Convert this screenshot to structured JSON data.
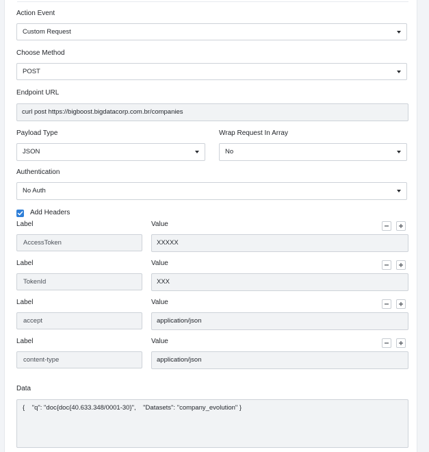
{
  "action_event": {
    "label": "Action Event",
    "value": "Custom Request"
  },
  "choose_method": {
    "label": "Choose Method",
    "value": "POST"
  },
  "endpoint_url": {
    "label": "Endpoint URL",
    "value": "curl post https://bigboost.bigdatacorp.com.br/companies"
  },
  "payload_type": {
    "label": "Payload Type",
    "value": "JSON"
  },
  "wrap_request": {
    "label": "Wrap Request In Array",
    "value": "No"
  },
  "authentication": {
    "label": "Authentication",
    "value": "No Auth"
  },
  "add_headers": {
    "label": "Add Headers",
    "checked": true
  },
  "headers": [
    {
      "label_title": "Label",
      "value_title": "Value",
      "label": "AccessToken",
      "value": "XXXXX"
    },
    {
      "label_title": "Label",
      "value_title": "Value",
      "label": "TokenId",
      "value": "XXX"
    },
    {
      "label_title": "Label",
      "value_title": "Value",
      "label": "accept",
      "value": "application/json"
    },
    {
      "label_title": "Label",
      "value_title": "Value",
      "label": "content-type",
      "value": "application/json"
    }
  ],
  "data": {
    "label": "Data",
    "value": "{    \"q\": \"doc{doc{40.633.348/0001-30}\",    \"Datasets\": \"company_evolution\" }"
  },
  "colors": {
    "accent": "#2f7fd8",
    "input_bg": "#f1f3f5",
    "border": "#cdd2d8"
  }
}
